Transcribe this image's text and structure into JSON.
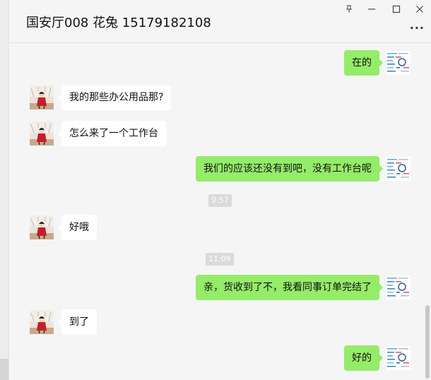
{
  "header": {
    "title": "国安厅008  花兔 15179182108",
    "more_label": "···"
  },
  "window_controls": {
    "pin_icon": "pin-icon",
    "minimize_icon": "minimize-icon",
    "maximize_icon": "maximize-icon",
    "close_icon": "close-icon"
  },
  "messages": [
    {
      "side": "right",
      "text": "在的"
    },
    {
      "side": "left",
      "text": "我的那些办公用品那?"
    },
    {
      "side": "left",
      "text": "怎么来了一个工作台"
    },
    {
      "side": "right",
      "text": "我们的应该还没有到吧，没有工作台呢"
    },
    {
      "side": "time",
      "text": "9:57"
    },
    {
      "side": "left",
      "text": "好哦"
    },
    {
      "side": "time",
      "text": "11:09"
    },
    {
      "side": "right",
      "text": "亲，货收到了不，我看同事订单完结了"
    },
    {
      "side": "left",
      "text": "到了"
    },
    {
      "side": "right",
      "text": "好的"
    }
  ],
  "colors": {
    "right_bubble": "#95ec69",
    "left_bubble": "#ffffff",
    "background": "#f5f5f5"
  }
}
